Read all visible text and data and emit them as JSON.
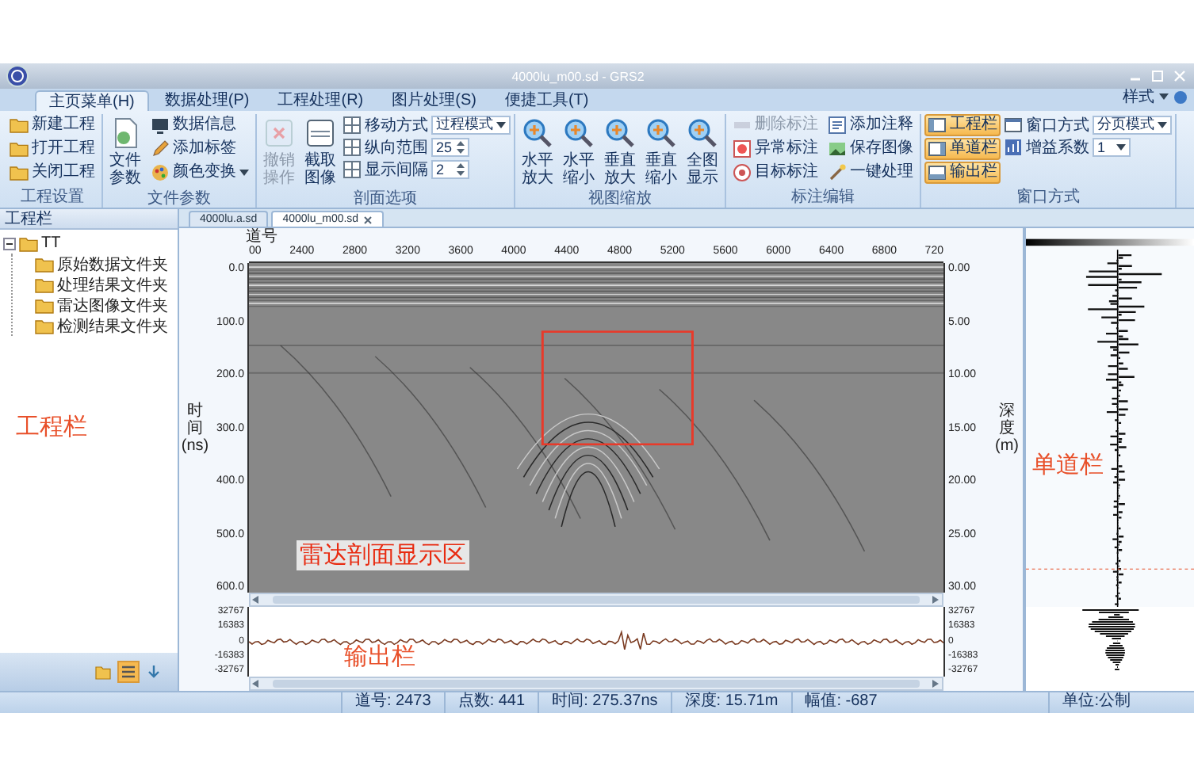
{
  "window": {
    "title": "4000lu_m00.sd - GRS2",
    "style_menu": "样式"
  },
  "ribbon": {
    "tabs": [
      {
        "label": "主页菜单(H)",
        "selected": true
      },
      {
        "label": "数据处理(P)",
        "selected": false
      },
      {
        "label": "工程处理(R)",
        "selected": false
      },
      {
        "label": "图片处理(S)",
        "selected": false
      },
      {
        "label": "便捷工具(T)",
        "selected": false
      }
    ],
    "groups": [
      {
        "label": "工程设置",
        "items": [
          {
            "kind": "small",
            "label": "新建工程",
            "disabled": false
          },
          {
            "kind": "small",
            "label": "打开工程",
            "disabled": false
          },
          {
            "kind": "small",
            "label": "关闭工程",
            "disabled": false
          }
        ]
      },
      {
        "label": "文件参数",
        "items": [
          {
            "kind": "large",
            "label": "文件参数",
            "disabled": false
          },
          {
            "kind": "small",
            "label": "数据信息",
            "disabled": false
          },
          {
            "kind": "small",
            "label": "添加标签",
            "disabled": false
          },
          {
            "kind": "menu",
            "label": "颜色变换",
            "disabled": false
          }
        ]
      },
      {
        "label": "剖面选项",
        "items": [
          {
            "kind": "large",
            "label": "撤销操作",
            "disabled": true
          },
          {
            "kind": "large",
            "label": "截取图像",
            "disabled": false
          },
          {
            "kind": "select",
            "label": "移动方式",
            "value": "过程模式",
            "disabled": false
          },
          {
            "kind": "spin",
            "label": "纵向范围",
            "value": "25",
            "disabled": false
          },
          {
            "kind": "spin",
            "label": "显示间隔",
            "value": "2",
            "disabled": false
          }
        ]
      },
      {
        "label": "视图缩放",
        "items": [
          {
            "kind": "large",
            "label": "水平放大",
            "disabled": false
          },
          {
            "kind": "large",
            "label": "水平缩小",
            "disabled": false
          },
          {
            "kind": "large",
            "label": "垂直放大",
            "disabled": false
          },
          {
            "kind": "large",
            "label": "垂直缩小",
            "disabled": false
          },
          {
            "kind": "large",
            "label": "全图显示",
            "disabled": false
          }
        ]
      },
      {
        "label": "标注编辑",
        "items": [
          {
            "kind": "small",
            "label": "删除标注",
            "disabled": true
          },
          {
            "kind": "small",
            "label": "异常标注",
            "disabled": false
          },
          {
            "kind": "small",
            "label": "目标标注",
            "disabled": false
          },
          {
            "kind": "small",
            "label": "添加注释",
            "disabled": false
          },
          {
            "kind": "small",
            "label": "保存图像",
            "disabled": false
          },
          {
            "kind": "small",
            "label": "一键处理",
            "disabled": false
          }
        ]
      },
      {
        "label": "窗口方式",
        "items": [
          {
            "kind": "toggle",
            "label": "工程栏",
            "on": true,
            "disabled": false
          },
          {
            "kind": "toggle",
            "label": "单道栏",
            "on": true,
            "disabled": false
          },
          {
            "kind": "toggle",
            "label": "输出栏",
            "on": true,
            "disabled": false
          },
          {
            "kind": "select",
            "label": "窗口方式",
            "value": "分页模式",
            "disabled": false
          },
          {
            "kind": "select",
            "label": "增益系数",
            "value": "1",
            "disabled": false
          }
        ]
      }
    ]
  },
  "sidebar": {
    "title": "工程栏",
    "tree": {
      "label": "TT",
      "expanded": true,
      "children": [
        {
          "label": "原始数据文件夹"
        },
        {
          "label": "处理结果文件夹"
        },
        {
          "label": "雷达图像文件夹"
        },
        {
          "label": "检测结果文件夹"
        }
      ]
    },
    "annotation": "工程栏",
    "tools": [
      {
        "selected": false
      },
      {
        "selected": true
      },
      {
        "selected": false
      }
    ]
  },
  "document_tabs": [
    {
      "label": "4000lu.a.sd",
      "selected": false
    },
    {
      "label": "4000lu_m00.sd",
      "selected": true
    }
  ],
  "profile": {
    "x_title": "道号",
    "x_ticks": [
      "00",
      "2400",
      "2800",
      "3200",
      "3600",
      "4000",
      "4400",
      "4800",
      "5200",
      "5600",
      "6000",
      "6400",
      "6800",
      "720"
    ],
    "y_title": "时间(ns)",
    "y_ticks": [
      "0.0",
      "100.0",
      "200.0",
      "300.0",
      "400.0",
      "500.0",
      "600.0"
    ],
    "depth_title": "深度(m)",
    "depth_ticks": [
      "0.00",
      "5.00",
      "10.00",
      "15.00",
      "20.00",
      "25.00",
      "30.00"
    ],
    "annotation": "雷达剖面显示区"
  },
  "trace": {
    "annotation": "单道栏"
  },
  "output": {
    "left_ticks": [
      "32767",
      "16383",
      "0",
      "-16383",
      "-32767"
    ],
    "right_ticks": [
      "32767",
      "16383",
      "0",
      "-16383",
      "-32767"
    ],
    "annotation": "输出栏"
  },
  "status_bar": [
    "道号: 2473",
    "点数: 441",
    "时间: 275.37ns",
    "深度: 15.71m",
    "幅值: -687",
    "单位:公制"
  ]
}
